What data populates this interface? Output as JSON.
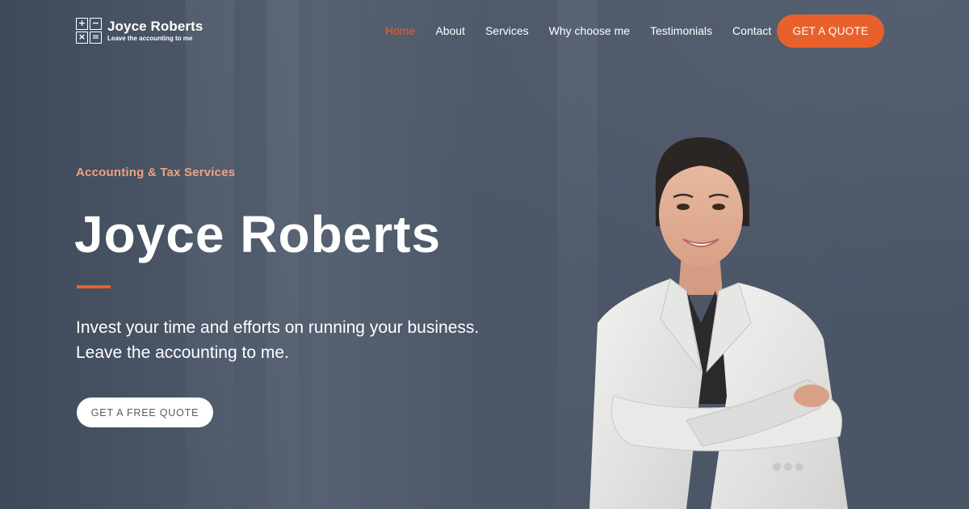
{
  "brand": {
    "name": "Joyce Roberts",
    "tagline": "Leave the accounting to me",
    "logo_icon": "calculator-icon",
    "logo_symbols": [
      "+",
      "−",
      "×",
      "="
    ]
  },
  "nav": {
    "items": [
      {
        "label": "Home",
        "active": true
      },
      {
        "label": "About",
        "active": false
      },
      {
        "label": "Services",
        "active": false
      },
      {
        "label": "Why choose me",
        "active": false
      },
      {
        "label": "Testimonials",
        "active": false
      },
      {
        "label": "Contact",
        "active": false
      }
    ],
    "cta_label": "GET A QUOTE"
  },
  "hero": {
    "eyebrow": "Accounting & Tax Services",
    "title": "Joyce Roberts",
    "subtitle_line1": "Invest your time and efforts on running your business.",
    "subtitle_line2": "Leave the accounting to me.",
    "cta_label": "GET A FREE QUOTE"
  },
  "colors": {
    "accent": "#e8612c",
    "eyebrow": "#eea282",
    "background": "#4a5566",
    "text": "#ffffff"
  }
}
